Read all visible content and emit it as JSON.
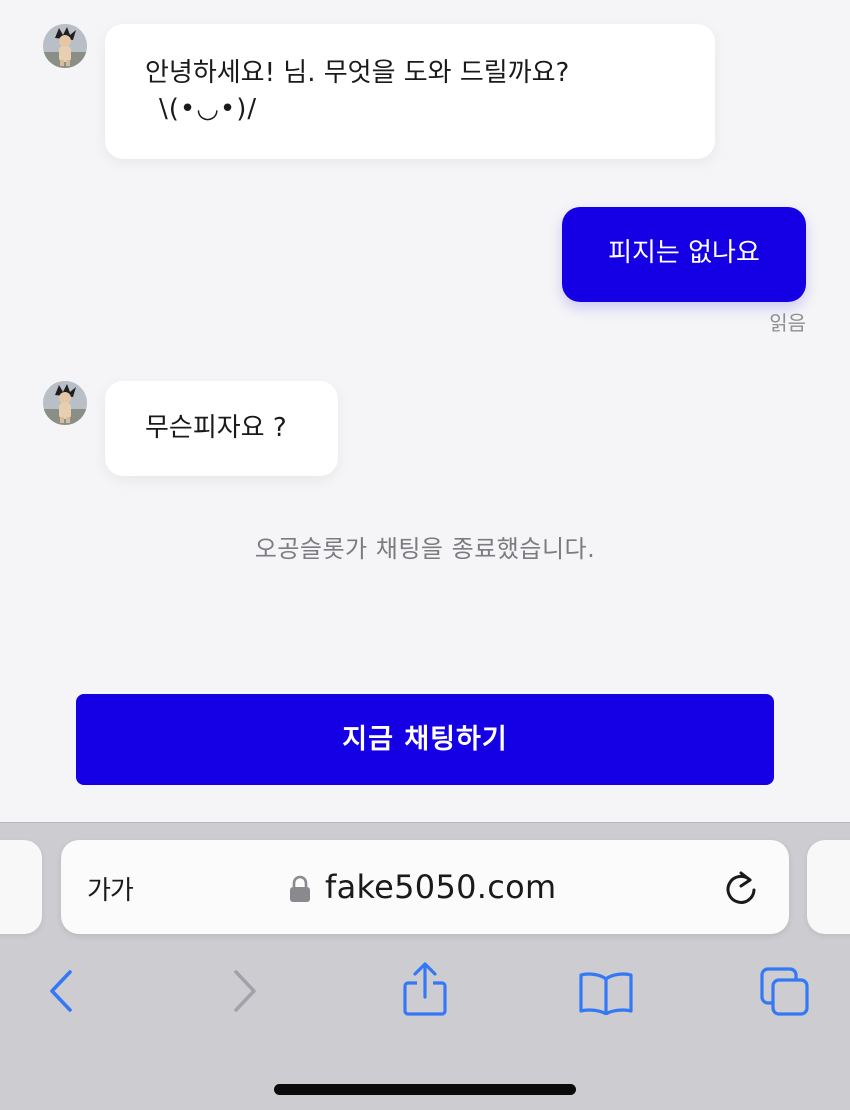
{
  "chat": {
    "messages": [
      {
        "sender": "agent",
        "lines": [
          "안녕하세요! 님. 무엇을 도와 드릴까요?",
          "\\(•◡•)/"
        ]
      },
      {
        "sender": "user",
        "text": "피지는 없나요",
        "status": "읽음"
      },
      {
        "sender": "agent",
        "text": "무슨피자요 ?"
      }
    ],
    "system_message": "오공슬롯가 채팅을 종료했습니다.",
    "chat_now_label": "지금 채팅하기"
  },
  "browser": {
    "text_size_label": "가가",
    "url": "fake5050.com",
    "accent_color": "#3478f6"
  },
  "theme": {
    "brand_color": "#1500e6",
    "background": "#f5f5f7"
  }
}
